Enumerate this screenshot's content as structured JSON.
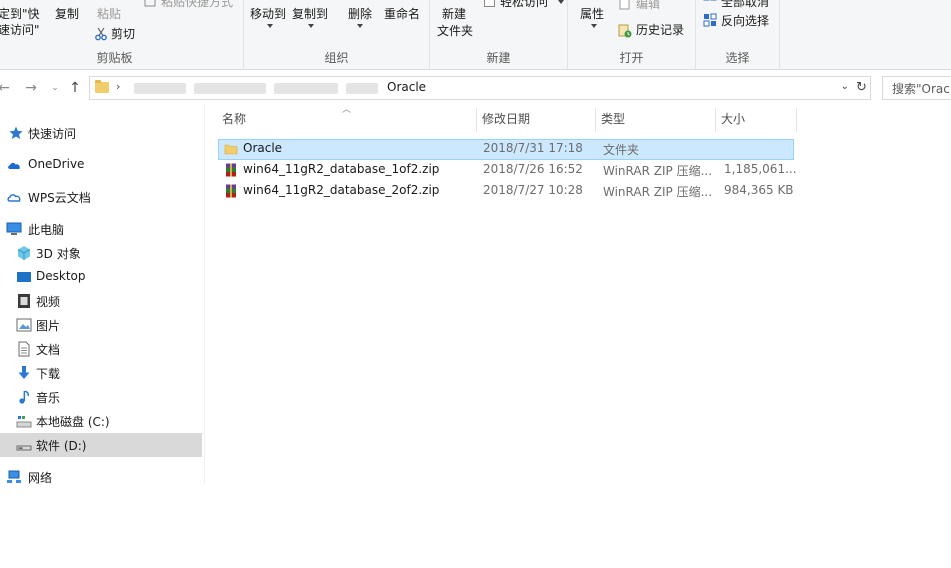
{
  "ribbon": {
    "clipboard": {
      "pin_label_line1": "定到\"快",
      "pin_label_line2": "速访问\"",
      "copy_label": "复制",
      "paste_label": "粘贴",
      "paste_shortcut_label": "粘贴快捷方式",
      "cut_label": "剪切",
      "group_label": "剪贴板"
    },
    "organize": {
      "move_to_label": "移动到",
      "copy_to_label": "复制到",
      "delete_label": "删除",
      "rename_label": "重命名",
      "group_label": "组织"
    },
    "new": {
      "new_folder_line1": "新建",
      "new_folder_line2": "文件夹",
      "easy_access_label": "轻松访问",
      "group_label": "新建"
    },
    "open": {
      "properties_label": "属性",
      "edit_label": "编辑",
      "history_label": "历史记录",
      "group_label": "打开"
    },
    "select": {
      "select_none_label": "全部取消",
      "invert_label": "反向选择",
      "group_label": "选择"
    }
  },
  "addressbar": {
    "current_folder": "Oracle",
    "search_placeholder": "搜索\"Oracle\""
  },
  "navpane": {
    "items": [
      {
        "label": "快速访问",
        "icon": "star-icon"
      },
      {
        "label": "OneDrive",
        "icon": "cloud-icon"
      },
      {
        "label": "WPS云文档",
        "icon": "cloud-outline-icon"
      },
      {
        "label": "此电脑",
        "icon": "computer-icon"
      },
      {
        "label": "3D 对象",
        "icon": "cube-icon"
      },
      {
        "label": "Desktop",
        "icon": "desktop-icon"
      },
      {
        "label": "视频",
        "icon": "video-icon"
      },
      {
        "label": "图片",
        "icon": "picture-icon"
      },
      {
        "label": "文档",
        "icon": "document-icon"
      },
      {
        "label": "下载",
        "icon": "download-icon"
      },
      {
        "label": "音乐",
        "icon": "music-icon"
      },
      {
        "label": "本地磁盘 (C:)",
        "icon": "drive-icon"
      },
      {
        "label": "软件 (D:)",
        "icon": "drive-icon"
      },
      {
        "label": "网络",
        "icon": "network-icon"
      }
    ]
  },
  "filelist": {
    "headers": {
      "name": "名称",
      "date": "修改日期",
      "type": "类型",
      "size": "大小"
    },
    "rows": [
      {
        "name": "Oracle",
        "date": "2018/7/31 17:18",
        "type": "文件夹",
        "size": "",
        "icon": "folder-icon"
      },
      {
        "name": "win64_11gR2_database_1of2.zip",
        "date": "2018/7/26 16:52",
        "type": "WinRAR ZIP 压缩...",
        "size": "1,185,061...",
        "icon": "winrar-icon"
      },
      {
        "name": "win64_11gR2_database_2of2.zip",
        "date": "2018/7/27 10:28",
        "type": "WinRAR ZIP 压缩...",
        "size": "984,365 KB",
        "icon": "winrar-icon"
      }
    ]
  },
  "colors": {
    "selection_bg": "#cce8ff",
    "selection_border": "#99d1ff",
    "nav_selected_bg": "#d9d9d9",
    "folder_yellow": "#f2cd6b"
  }
}
